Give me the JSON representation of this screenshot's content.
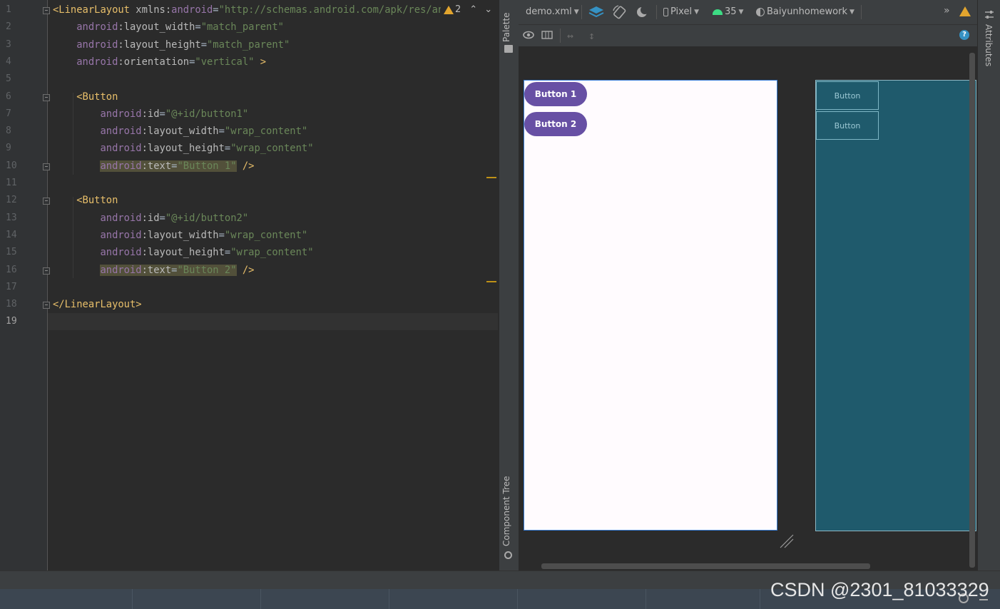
{
  "editor": {
    "line_numbers": [
      "1",
      "2",
      "3",
      "4",
      "5",
      "6",
      "7",
      "8",
      "9",
      "10",
      "11",
      "12",
      "13",
      "14",
      "15",
      "16",
      "17",
      "18",
      "19"
    ],
    "lines": [
      [
        {
          "c": "tag",
          "t": "<LinearLayout "
        },
        {
          "c": "attr",
          "t": "xmlns:"
        },
        {
          "c": "ns",
          "t": "android"
        },
        {
          "c": "plain",
          "t": "="
        },
        {
          "c": "val",
          "t": "\"http://schemas.android.com/apk/res/andr"
        }
      ],
      [
        {
          "c": "plain",
          "t": "    "
        },
        {
          "c": "ns",
          "t": "android"
        },
        {
          "c": "attr",
          "t": ":layout_width"
        },
        {
          "c": "plain",
          "t": "="
        },
        {
          "c": "val",
          "t": "\"match_parent\""
        }
      ],
      [
        {
          "c": "plain",
          "t": "    "
        },
        {
          "c": "ns",
          "t": "android"
        },
        {
          "c": "attr",
          "t": ":layout_height"
        },
        {
          "c": "plain",
          "t": "="
        },
        {
          "c": "val",
          "t": "\"match_parent\""
        }
      ],
      [
        {
          "c": "plain",
          "t": "    "
        },
        {
          "c": "ns",
          "t": "android"
        },
        {
          "c": "attr",
          "t": ":orientation"
        },
        {
          "c": "plain",
          "t": "="
        },
        {
          "c": "val",
          "t": "\"vertical\""
        },
        {
          "c": "tag",
          "t": " >"
        }
      ],
      [],
      [
        {
          "c": "plain",
          "t": "    "
        },
        {
          "c": "tag",
          "t": "<Button"
        }
      ],
      [
        {
          "c": "plain",
          "t": "        "
        },
        {
          "c": "ns",
          "t": "android"
        },
        {
          "c": "attr",
          "t": ":id"
        },
        {
          "c": "plain",
          "t": "="
        },
        {
          "c": "val",
          "t": "\"@+id/button1\""
        }
      ],
      [
        {
          "c": "plain",
          "t": "        "
        },
        {
          "c": "ns",
          "t": "android"
        },
        {
          "c": "attr",
          "t": ":layout_width"
        },
        {
          "c": "plain",
          "t": "="
        },
        {
          "c": "val",
          "t": "\"wrap_content\""
        }
      ],
      [
        {
          "c": "plain",
          "t": "        "
        },
        {
          "c": "ns",
          "t": "android"
        },
        {
          "c": "attr",
          "t": ":layout_height"
        },
        {
          "c": "plain",
          "t": "="
        },
        {
          "c": "val",
          "t": "\"wrap_content\""
        }
      ],
      [
        {
          "c": "plain",
          "t": "        "
        },
        {
          "c": "ns hl",
          "t": "android"
        },
        {
          "c": "attr hl",
          "t": ":text"
        },
        {
          "c": "plain hl",
          "t": "="
        },
        {
          "c": "val hl",
          "t": "\"Button 1\""
        },
        {
          "c": "tag",
          "t": " />"
        }
      ],
      [],
      [
        {
          "c": "plain",
          "t": "    "
        },
        {
          "c": "tag",
          "t": "<Button"
        }
      ],
      [
        {
          "c": "plain",
          "t": "        "
        },
        {
          "c": "ns",
          "t": "android"
        },
        {
          "c": "attr",
          "t": ":id"
        },
        {
          "c": "plain",
          "t": "="
        },
        {
          "c": "val",
          "t": "\"@+id/button2\""
        }
      ],
      [
        {
          "c": "plain",
          "t": "        "
        },
        {
          "c": "ns",
          "t": "android"
        },
        {
          "c": "attr",
          "t": ":layout_width"
        },
        {
          "c": "plain",
          "t": "="
        },
        {
          "c": "val",
          "t": "\"wrap_content\""
        }
      ],
      [
        {
          "c": "plain",
          "t": "        "
        },
        {
          "c": "ns",
          "t": "android"
        },
        {
          "c": "attr",
          "t": ":layout_height"
        },
        {
          "c": "plain",
          "t": "="
        },
        {
          "c": "val",
          "t": "\"wrap_content\""
        }
      ],
      [
        {
          "c": "plain",
          "t": "        "
        },
        {
          "c": "ns hl",
          "t": "android"
        },
        {
          "c": "attr hl",
          "t": ":text"
        },
        {
          "c": "plain hl",
          "t": "="
        },
        {
          "c": "val hl",
          "t": "\"Button 2\""
        },
        {
          "c": "tag",
          "t": " />"
        }
      ],
      [],
      [
        {
          "c": "tag",
          "t": "</LinearLayout>"
        }
      ],
      []
    ],
    "warning_count": "2"
  },
  "side_tabs": {
    "palette": "Palette",
    "component_tree": "Component Tree",
    "attributes": "Attributes"
  },
  "toolbar": {
    "file": "demo.xml",
    "device": "Pixel",
    "api": "35",
    "theme": "Baiyunhomework"
  },
  "design_preview": {
    "button1": "Button 1",
    "button2": "Button 2"
  },
  "blueprint": {
    "button1": "Button",
    "button2": "Button"
  },
  "colors": {
    "button_purple": "#6750a4",
    "blueprint_bg": "#1f5a6c",
    "warning": "#e2a52e"
  },
  "watermark": "CSDN @2301_81033329"
}
